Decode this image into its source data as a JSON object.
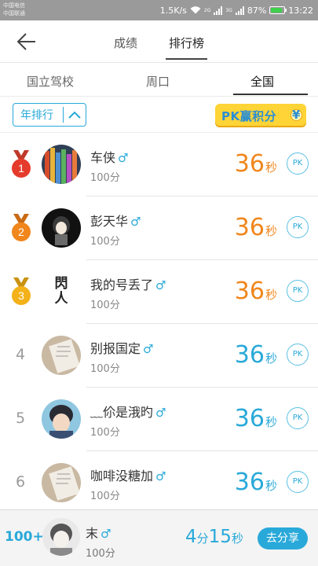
{
  "status_bar": {
    "carrier_line1": "中国电信",
    "carrier_line2": "中国联通",
    "speed": "1.5K/s",
    "net1": "2G",
    "net2": "3G",
    "battery": "87%",
    "time": "13:22"
  },
  "header": {
    "back_icon": "arrow-left-icon",
    "tabs": [
      {
        "label": "成绩"
      },
      {
        "label": "排行榜"
      }
    ]
  },
  "scope_tabs": [
    {
      "label": "国立驾校"
    },
    {
      "label": "周口"
    },
    {
      "label": "全国"
    }
  ],
  "filter": {
    "label": "年排行",
    "icon": "chevron-up-icon"
  },
  "pk_banner": {
    "label": "PK赢积分",
    "coin": "¥"
  },
  "colors": {
    "accent": "#29a9d9",
    "orange": "#f0861c",
    "gold": "#f3b11a"
  },
  "leaderboard": [
    {
      "rank": "1",
      "name": "车侠",
      "gender": "♂",
      "score": "100分",
      "time_value": "36",
      "time_unit": "秒",
      "pk": "PK"
    },
    {
      "rank": "2",
      "name": "彭天华",
      "gender": "♂",
      "score": "100分",
      "time_value": "36",
      "time_unit": "秒",
      "pk": "PK"
    },
    {
      "rank": "3",
      "name": "我的号丢了",
      "gender": "♂",
      "score": "100分",
      "time_value": "36",
      "time_unit": "秒",
      "pk": "PK",
      "avatar_text": "閃人"
    },
    {
      "rank": "4",
      "name": "别报国定",
      "gender": "♂",
      "score": "100分",
      "time_value": "36",
      "time_unit": "秒",
      "pk": "PK"
    },
    {
      "rank": "5",
      "name": "﹏伱是涐旳",
      "gender": "♂",
      "score": "100分",
      "time_value": "36",
      "time_unit": "秒",
      "pk": "PK"
    },
    {
      "rank": "6",
      "name": "咖啡没糖加",
      "gender": "♂",
      "score": "100分",
      "time_value": "36",
      "time_unit": "秒",
      "pk": "PK"
    }
  ],
  "my_entry": {
    "rank": "100+",
    "name": "末",
    "gender": "♂",
    "score": "100分",
    "time_min": "4",
    "time_min_unit": "分",
    "time_sec": "15",
    "time_sec_unit": "秒",
    "share_label": "去分享"
  }
}
